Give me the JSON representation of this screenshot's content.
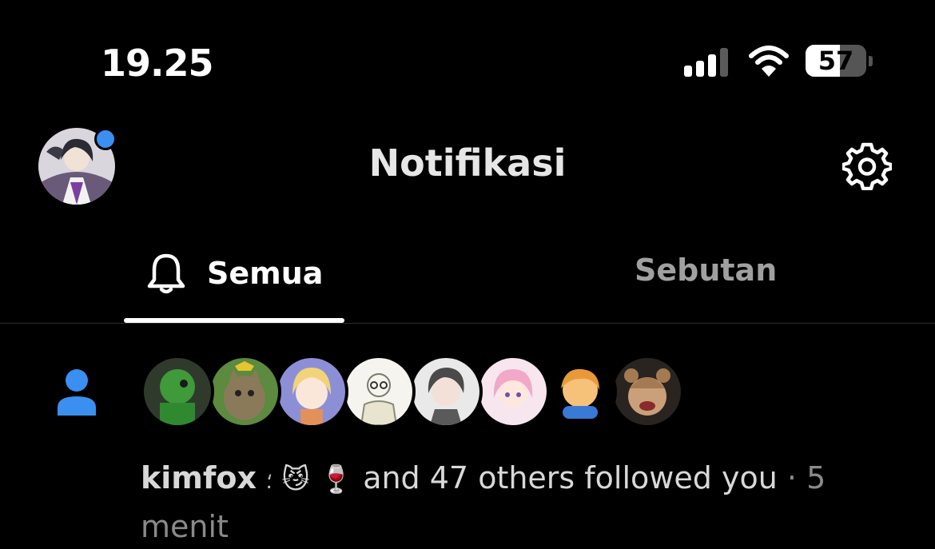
{
  "status_bar": {
    "time": "19.25",
    "battery_percent": "57",
    "battery_level": 0.57,
    "signal_bars": 3
  },
  "header": {
    "title": "Notifikasi",
    "icons": {
      "settings": "gear-icon",
      "avatar_status": "online-dot"
    }
  },
  "tabs": [
    {
      "label": "Semua",
      "icon": "bell-icon",
      "active": true
    },
    {
      "label": "Sebutan",
      "active": false
    }
  ],
  "notification": {
    "icon": "person-icon",
    "icon_color": "#3a8ff0",
    "username": "kimfox",
    "username_decoration": "⸵",
    "emojis": [
      "😼",
      "🍷"
    ],
    "message": "and 47 others followed you",
    "separator": "·",
    "time": "5 menit",
    "avatar_count": 8
  },
  "colors": {
    "background": "#000000",
    "accent": "#3a8ff0",
    "inactive_tab": "#a0a0a0",
    "divider": "#2b2b2b"
  }
}
